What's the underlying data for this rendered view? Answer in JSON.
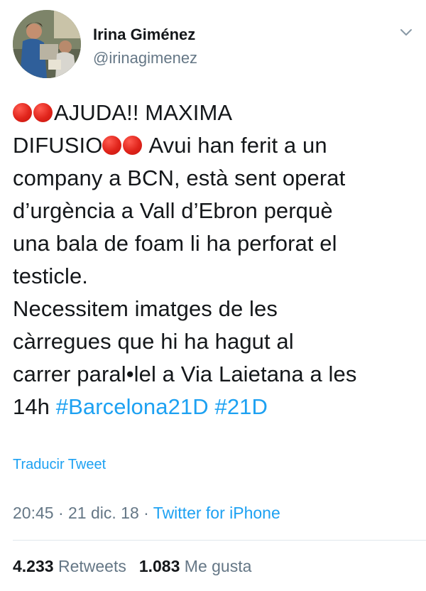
{
  "author": {
    "display_name": "Irina Giménez",
    "handle": "@irinagimenez"
  },
  "tweet": {
    "line1": "AJUDA!! MAXIMA",
    "line2_prefix": "DIFUSIO",
    "line2_suffix": " Avui han ferit a un",
    "line3": "company a BCN, està sent operat",
    "line4": "d’urgència a Vall d’Ebron perquè",
    "line5": "una bala de foam li ha perforat el",
    "line6": "testicle.",
    "line7": "Necessitem imatges de les",
    "line8": "càrregues que hi ha hagut al",
    "line9": "carrer paral•lel a Via Laietana a les",
    "line10_prefix": "14h ",
    "hashtags": [
      "#Barcelona21D",
      "#21D"
    ],
    "emoji": "red-circle-emoji"
  },
  "translate_label": "Traducir Tweet",
  "meta": {
    "time": "20:45",
    "separator": " · ",
    "date": "21 dic. 18",
    "source": "Twitter for iPhone"
  },
  "stats": {
    "retweets_count": "4.233",
    "retweets_label": "Retweets",
    "likes_count": "1.083",
    "likes_label": "Me gusta"
  },
  "colors": {
    "link": "#1da1f2",
    "text": "#14171a",
    "secondary": "#657786",
    "emoji_red": "#e0241b"
  }
}
